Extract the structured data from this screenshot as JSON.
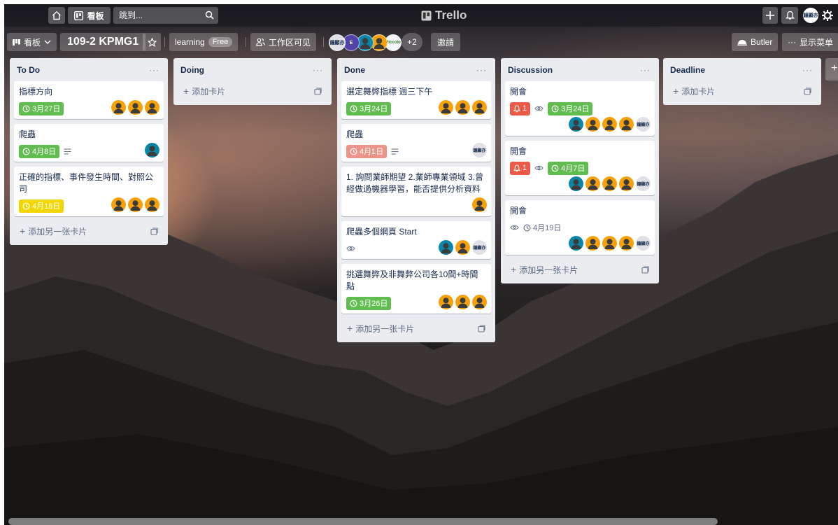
{
  "header": {
    "home_icon": "home-icon",
    "boards_label": "看板",
    "jump_placeholder": "跳到...",
    "logo_text": "Trello",
    "user_initials": "鐘顯亦"
  },
  "board": {
    "view_label": "看板",
    "name": "109-2 KPMG1",
    "workspace_name": "learning",
    "workspace_badge": "Free",
    "visibility_label": "工作区可见",
    "members": [
      {
        "initials": "鐘顯亦",
        "color": "#dfe1e6"
      },
      {
        "initials": "E",
        "color": "#5243aa"
      },
      {
        "initials": "",
        "color": "#0a87a8"
      },
      {
        "initials": "",
        "color": "#f6a10a"
      },
      {
        "initials": "Piccolo",
        "color": "#f4f5f7"
      }
    ],
    "more_members": "+2",
    "invite_label": "邀請",
    "butler_label": "Butler",
    "show_menu_label": "显示菜单"
  },
  "add_card_label": "添加卡片",
  "add_another_card_label": "添加另一张卡片",
  "lists": [
    {
      "title": "To Do",
      "cards": [
        {
          "title": "指標方向",
          "due": "3月27日",
          "due_color": "green",
          "members": [
            "orange",
            "orange",
            "orange"
          ]
        },
        {
          "title": "爬蟲",
          "due": "4月8日",
          "due_color": "green",
          "description": true,
          "members": [
            "teal"
          ]
        },
        {
          "title": "正確的指標、事件發生時間、對照公司",
          "due": "4月18日",
          "due_color": "yellow",
          "members": [
            "orange",
            "orange",
            "orange"
          ]
        }
      ]
    },
    {
      "title": "Doing",
      "cards": []
    },
    {
      "title": "Done",
      "cards": [
        {
          "title": "選定舞弊指標 週三下午",
          "due": "3月24日",
          "due_color": "green",
          "members": [
            "orange",
            "orange",
            "orange"
          ]
        },
        {
          "title": "爬蟲",
          "due": "4月1日",
          "due_color": "red",
          "description": true,
          "members": [
            "gray:鐘顯亦"
          ]
        },
        {
          "title": "1. 詢問業師期望 2.業師專業領域 3.曾經做過機器學習，能否提供分析資料",
          "members": [
            "orange"
          ]
        },
        {
          "title": "爬蟲多個網頁 Start",
          "watch": true,
          "members": [
            "teal",
            "orange",
            "gray:鐘顯亦"
          ]
        },
        {
          "title": "挑選舞弊及非舞弊公司各10間+時間點",
          "due": "3月26日",
          "due_color": "green",
          "members": [
            "orange",
            "orange",
            "orange"
          ]
        }
      ]
    },
    {
      "title": "Discussion",
      "cards": [
        {
          "title": "開會",
          "notifications": "1",
          "watch": true,
          "due": "3月24日",
          "due_color": "green",
          "members": [
            "teal",
            "orange",
            "orange",
            "orange",
            "gray:鐘顯亦"
          ]
        },
        {
          "title": "開會",
          "notifications": "1",
          "watch": true,
          "due": "4月7日",
          "due_color": "green",
          "members": [
            "teal",
            "orange",
            "orange",
            "orange",
            "gray:鐘顯亦"
          ]
        },
        {
          "title": "開會",
          "watch": true,
          "due": "4月19日",
          "due_color": "plain",
          "members": [
            "teal",
            "orange",
            "orange",
            "orange",
            "gray:鐘顯亦"
          ]
        }
      ]
    },
    {
      "title": "Deadline",
      "cards": []
    }
  ]
}
